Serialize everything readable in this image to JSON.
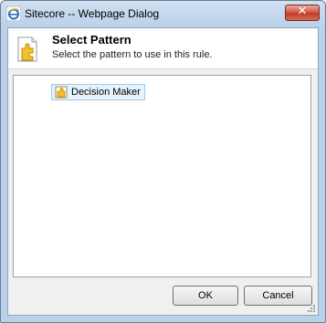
{
  "window": {
    "title": "Sitecore -- Webpage Dialog",
    "close_label": "✕"
  },
  "header": {
    "title": "Select Pattern",
    "subtitle": "Select the pattern to use in this rule."
  },
  "tree": {
    "items": [
      {
        "label": "Decision Maker",
        "icon": "persona-icon",
        "selected": true
      }
    ]
  },
  "buttons": {
    "ok": "OK",
    "cancel": "Cancel"
  },
  "colors": {
    "accent": "#d2533f",
    "selection": "#e6f2fc"
  }
}
